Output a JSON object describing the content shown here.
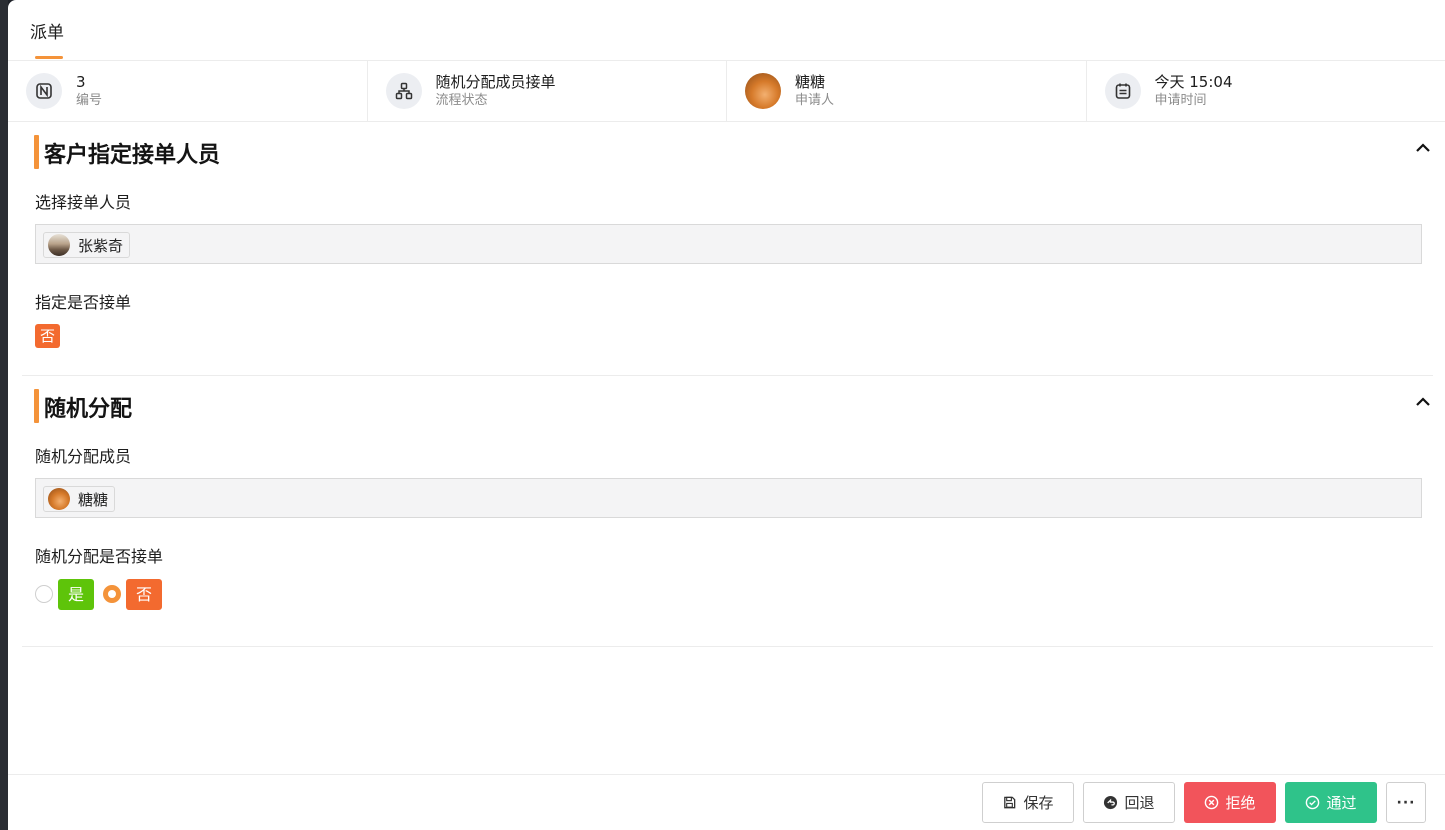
{
  "tab": {
    "label": "派单"
  },
  "info": [
    {
      "value": "3",
      "label": "编号",
      "icon": "notion-icon"
    },
    {
      "value": "随机分配成员接单",
      "label": "流程状态",
      "icon": "flow-icon"
    },
    {
      "value": "糖糖",
      "label": "申请人",
      "icon": "avatar"
    },
    {
      "value": "今天 15:04",
      "label": "申请时间",
      "icon": "calendar-icon"
    }
  ],
  "sections": [
    {
      "title": "客户指定接单人员",
      "fields": {
        "select_label": "选择接单人员",
        "selected_user": "张紫奇",
        "accept_label": "指定是否接单",
        "accept_value": "否"
      }
    },
    {
      "title": "随机分配",
      "fields": {
        "member_label": "随机分配成员",
        "selected_user": "糖糖",
        "accept_label": "随机分配是否接单",
        "options": [
          {
            "label": "是",
            "selected": false
          },
          {
            "label": "否",
            "selected": true
          }
        ]
      }
    }
  ],
  "footer": {
    "save": "保存",
    "back": "回退",
    "reject": "拒绝",
    "pass": "通过",
    "more": "···"
  },
  "colors": {
    "accent": "#f4933a",
    "reject": "#f2545b",
    "pass": "#2fc38a",
    "yes": "#5ec40a",
    "no": "#f36a2f"
  }
}
